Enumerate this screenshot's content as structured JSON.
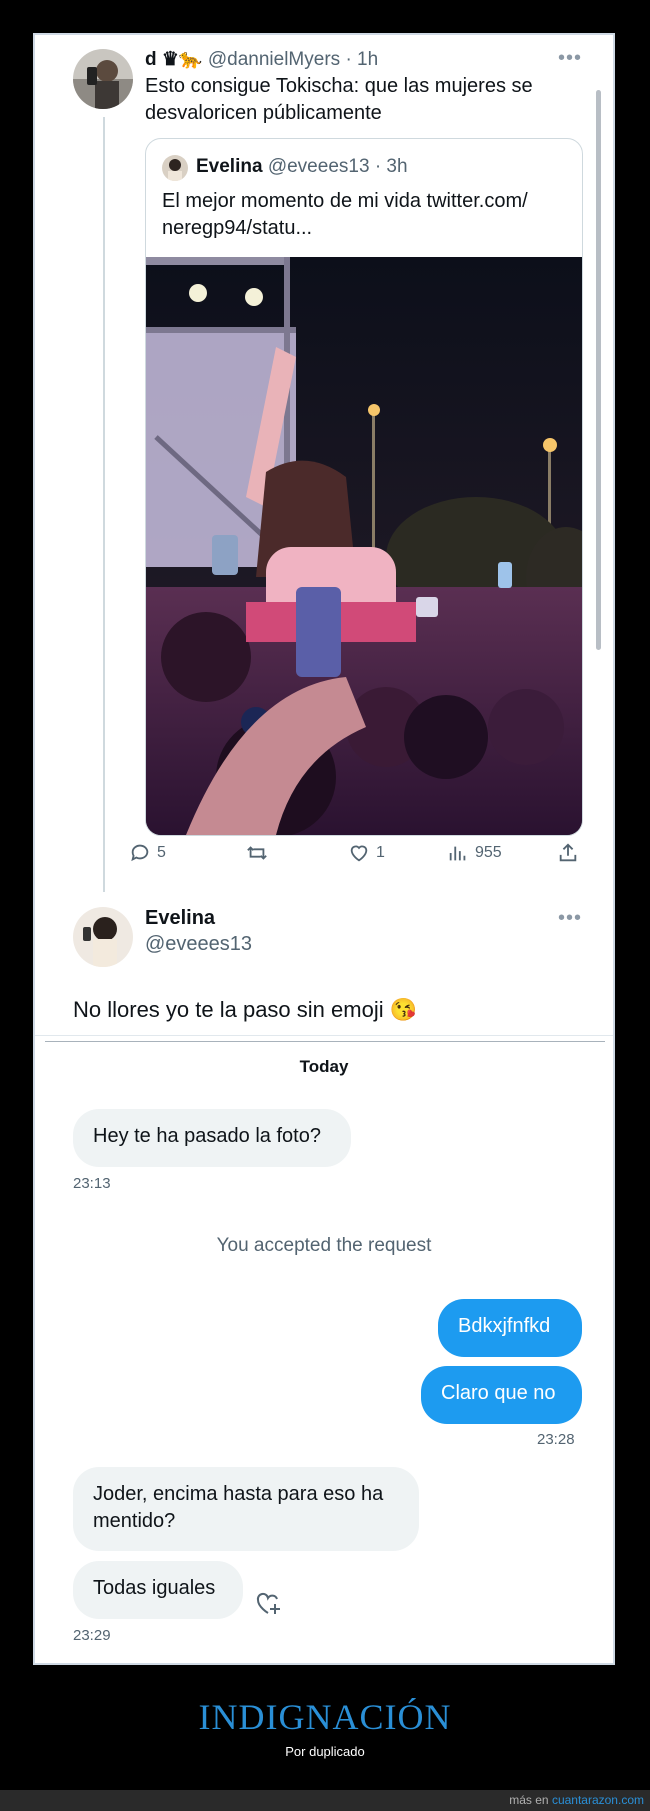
{
  "tweet": {
    "display_name": "d ♛🐆",
    "handle": "@dannielMyers",
    "time": "· 1h",
    "text_line1": "Esto consigue Tokischa: que las mujeres se",
    "text_line2": "desvaloricen públicamente",
    "more_icon": "more-icon",
    "quote": {
      "name": "Evelina",
      "handle": "@eveees13",
      "time": "· 3h",
      "text_line1": "El mejor momento de mi vida twitter.com/",
      "text_line2": "neregp94/statu..."
    },
    "actions": {
      "replies": "5",
      "retweets": "",
      "likes": "1",
      "views": "955"
    }
  },
  "reply": {
    "name": "Evelina",
    "handle": "@eveees13",
    "text": "No llores yo te la paso sin emoji 😘"
  },
  "dm": {
    "day": "Today",
    "msg1": "Hey te ha pasado la foto?",
    "time1": "23:13",
    "system": "You accepted the request",
    "msg2": "Bdkxjfnfkd",
    "msg3": "Claro que no",
    "time2": "23:28",
    "msg4_line1": "Joder, encima hasta para eso ha",
    "msg4_line2": "mentido?",
    "msg5": "Todas iguales",
    "time3": "23:29"
  },
  "footer": {
    "title": "INDIGNACIÓN",
    "subtitle": "Por duplicado",
    "bottom_prefix": "más en",
    "bottom_site": "cuantarazon.com"
  },
  "colors": {
    "accent": "#1d9bf0",
    "footer_title": "#2a8fd6"
  }
}
